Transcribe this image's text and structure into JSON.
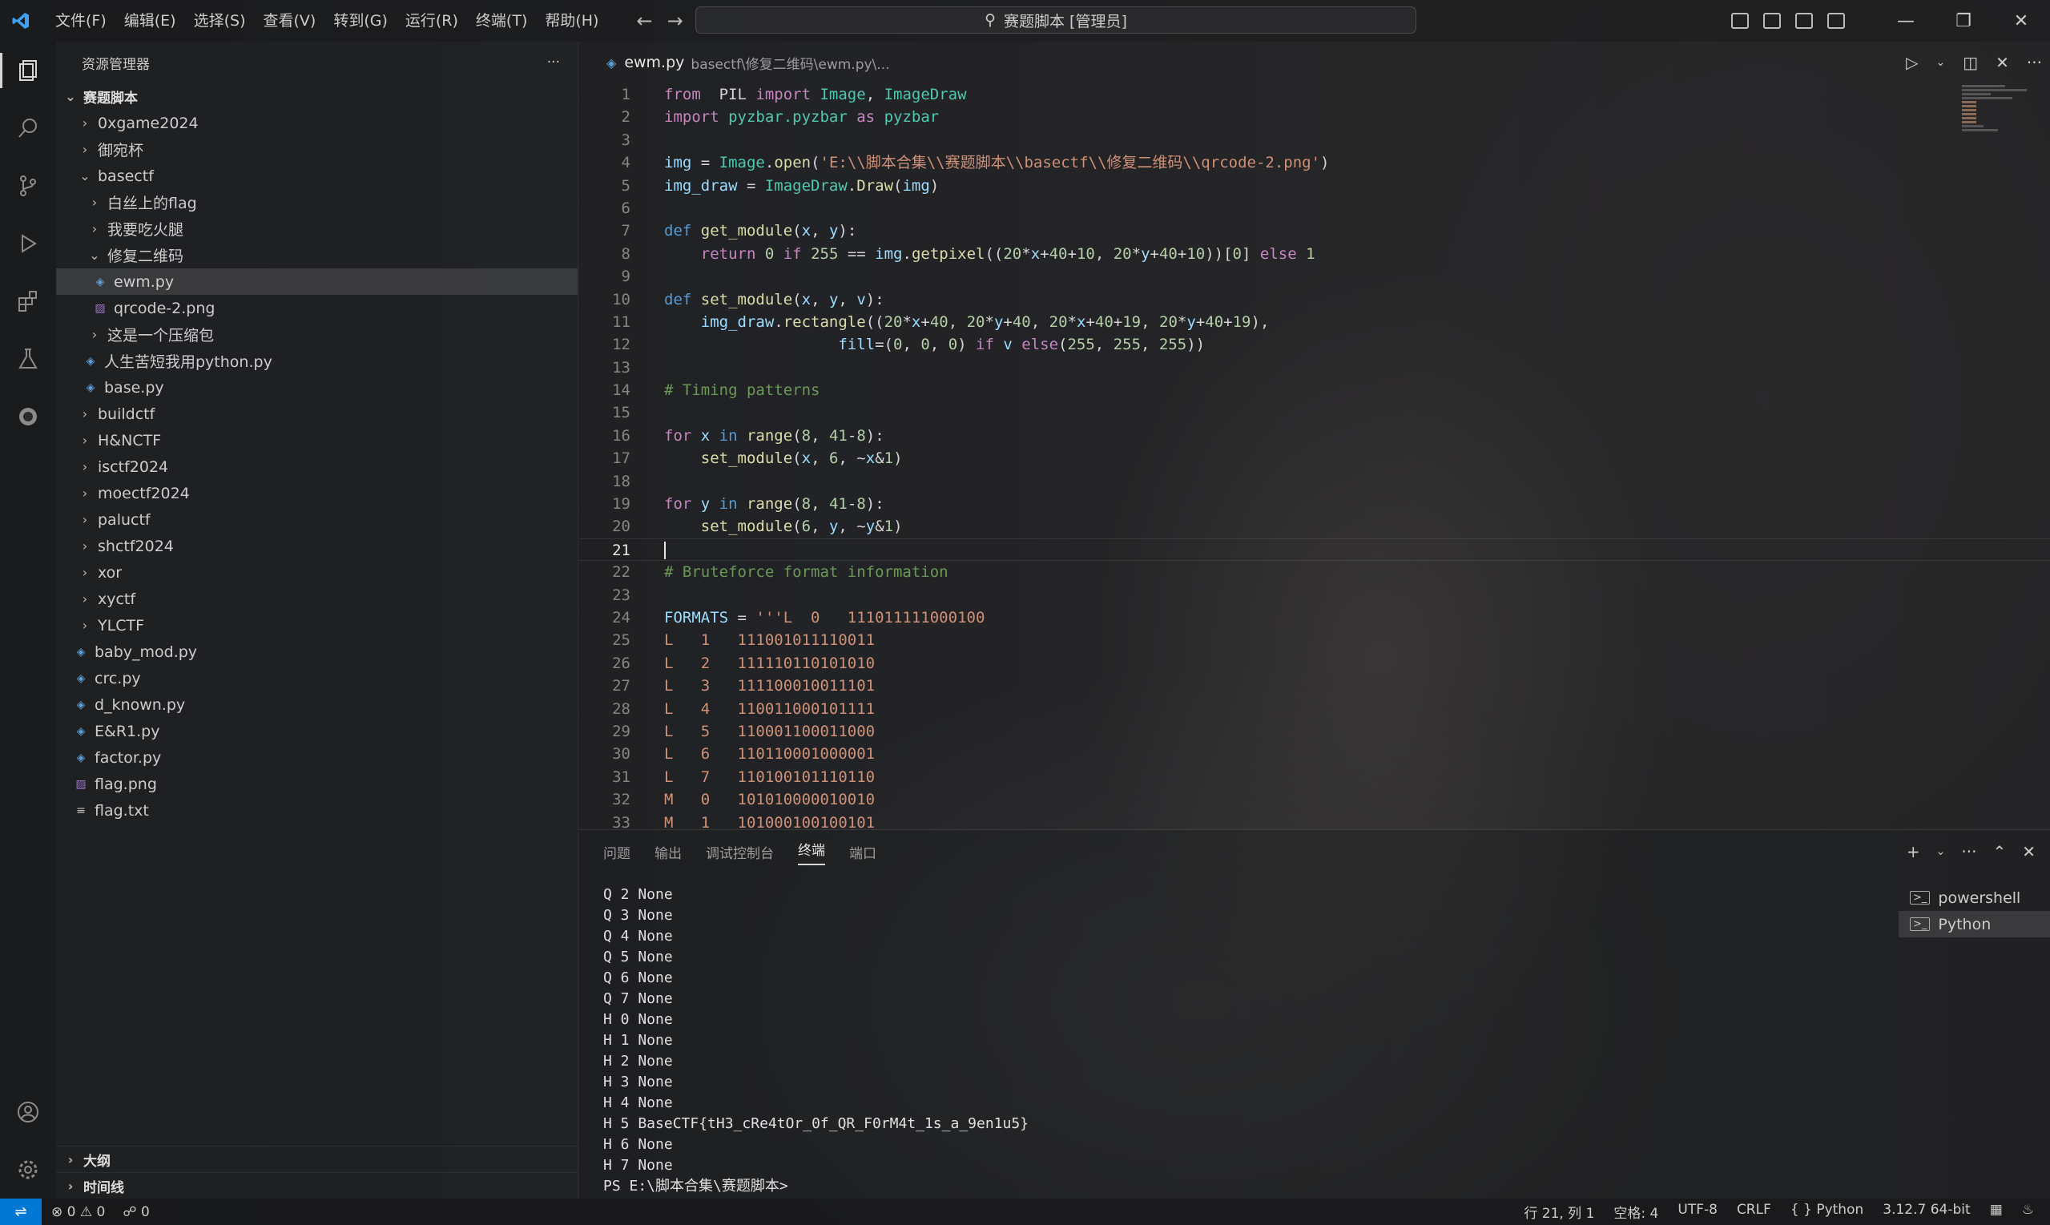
{
  "titlebar": {
    "menus": [
      "文件(F)",
      "编辑(E)",
      "选择(S)",
      "查看(V)",
      "转到(G)",
      "运行(R)",
      "终端(T)",
      "帮助(H)"
    ],
    "search": "赛题脚本 [管理员]"
  },
  "sidebar": {
    "header": "资源管理器",
    "root": "赛题脚本",
    "tree": [
      {
        "label": "0xgame2024",
        "indent": 1,
        "type": "folder",
        "open": false
      },
      {
        "label": "御宛杯",
        "indent": 1,
        "type": "folder",
        "open": false
      },
      {
        "label": "basectf",
        "indent": 1,
        "type": "folder",
        "open": true
      },
      {
        "label": "白丝上的flag",
        "indent": 2,
        "type": "folder",
        "open": false
      },
      {
        "label": "我要吃火腿",
        "indent": 2,
        "type": "folder",
        "open": false
      },
      {
        "label": "修复二维码",
        "indent": 2,
        "type": "folder",
        "open": true
      },
      {
        "label": "ewm.py",
        "indent": 3,
        "type": "py",
        "selected": true
      },
      {
        "label": "qrcode-2.png",
        "indent": 3,
        "type": "png"
      },
      {
        "label": "这是一个压缩包",
        "indent": 2,
        "type": "folder",
        "open": false
      },
      {
        "label": "人生苦短我用python.py",
        "indent": 2,
        "type": "py"
      },
      {
        "label": "base.py",
        "indent": 2,
        "type": "py"
      },
      {
        "label": "buildctf",
        "indent": 1,
        "type": "folder",
        "open": false
      },
      {
        "label": "H&NCTF",
        "indent": 1,
        "type": "folder",
        "open": false
      },
      {
        "label": "isctf2024",
        "indent": 1,
        "type": "folder",
        "open": false
      },
      {
        "label": "moectf2024",
        "indent": 1,
        "type": "folder",
        "open": false
      },
      {
        "label": "paluctf",
        "indent": 1,
        "type": "folder",
        "open": false
      },
      {
        "label": "shctf2024",
        "indent": 1,
        "type": "folder",
        "open": false
      },
      {
        "label": "xor",
        "indent": 1,
        "type": "folder",
        "open": false
      },
      {
        "label": "xyctf",
        "indent": 1,
        "type": "folder",
        "open": false
      },
      {
        "label": "YLCTF",
        "indent": 1,
        "type": "folder",
        "open": false
      },
      {
        "label": "baby_mod.py",
        "indent": 1,
        "type": "py"
      },
      {
        "label": "crc.py",
        "indent": 1,
        "type": "py"
      },
      {
        "label": "d_known.py",
        "indent": 1,
        "type": "py"
      },
      {
        "label": "E&R1.py",
        "indent": 1,
        "type": "py"
      },
      {
        "label": "factor.py",
        "indent": 1,
        "type": "py"
      },
      {
        "label": "flag.png",
        "indent": 1,
        "type": "png"
      },
      {
        "label": "flag.txt",
        "indent": 1,
        "type": "txt"
      }
    ],
    "outline": "大纲",
    "timeline": "时间线"
  },
  "editor": {
    "tab_title": "ewm.py",
    "tab_path": "basectf\\修复二维码\\ewm.py\\...",
    "current_line": 21,
    "lines": [
      [
        [
          "kw2",
          "from"
        ],
        [
          "",
          "  PIL "
        ],
        [
          "kw2",
          "import"
        ],
        [
          "cls",
          " Image"
        ],
        [
          "",
          ", "
        ],
        [
          "cls",
          "ImageDraw"
        ]
      ],
      [
        [
          "kw2",
          "import"
        ],
        [
          "cls",
          " pyzbar.pyzbar"
        ],
        [
          "kw2",
          " as"
        ],
        [
          "cls",
          " pyzbar"
        ]
      ],
      [],
      [
        [
          "var",
          "img"
        ],
        [
          "",
          " = "
        ],
        [
          "cls",
          "Image"
        ],
        [
          "",
          "."
        ],
        [
          "fn",
          "open"
        ],
        [
          "",
          "("
        ],
        [
          "str",
          "'E:\\\\脚本合集\\\\赛题脚本\\\\basectf\\\\修复二维码\\\\qrcode-2.png'"
        ],
        [
          "",
          ")"
        ]
      ],
      [
        [
          "var",
          "img_draw"
        ],
        [
          "",
          " = "
        ],
        [
          "cls",
          "ImageDraw"
        ],
        [
          "",
          "."
        ],
        [
          "fn",
          "Draw"
        ],
        [
          "",
          "("
        ],
        [
          "var",
          "img"
        ],
        [
          "",
          ")"
        ]
      ],
      [],
      [
        [
          "kw",
          "def"
        ],
        [
          "fn",
          " get_module"
        ],
        [
          "",
          "("
        ],
        [
          "var",
          "x"
        ],
        [
          "",
          ", "
        ],
        [
          "var",
          "y"
        ],
        [
          "",
          "):"
        ]
      ],
      [
        [
          "",
          "    "
        ],
        [
          "kw2",
          "return"
        ],
        [
          "num",
          " 0"
        ],
        [
          "kw2",
          " if"
        ],
        [
          "num",
          " 255"
        ],
        [
          "",
          " == "
        ],
        [
          "var",
          "img"
        ],
        [
          "",
          "."
        ],
        [
          "fn",
          "getpixel"
        ],
        [
          "",
          "(("
        ],
        [
          "num",
          "20"
        ],
        [
          "",
          "*"
        ],
        [
          "var",
          "x"
        ],
        [
          "",
          "+"
        ],
        [
          "num",
          "40"
        ],
        [
          "",
          "+"
        ],
        [
          "num",
          "10"
        ],
        [
          "",
          ", "
        ],
        [
          "num",
          "20"
        ],
        [
          "",
          "*"
        ],
        [
          "var",
          "y"
        ],
        [
          "",
          "+"
        ],
        [
          "num",
          "40"
        ],
        [
          "",
          "+"
        ],
        [
          "num",
          "10"
        ],
        [
          "",
          "))["
        ],
        [
          "num",
          "0"
        ],
        [
          "",
          "] "
        ],
        [
          "kw2",
          "else"
        ],
        [
          "num",
          " 1"
        ]
      ],
      [],
      [
        [
          "kw",
          "def"
        ],
        [
          "fn",
          " set_module"
        ],
        [
          "",
          "("
        ],
        [
          "var",
          "x"
        ],
        [
          "",
          ", "
        ],
        [
          "var",
          "y"
        ],
        [
          "",
          ", "
        ],
        [
          "var",
          "v"
        ],
        [
          "",
          "):"
        ]
      ],
      [
        [
          "",
          "    "
        ],
        [
          "var",
          "img_draw"
        ],
        [
          "",
          "."
        ],
        [
          "fn",
          "rectangle"
        ],
        [
          "",
          "(("
        ],
        [
          "num",
          "20"
        ],
        [
          "",
          "*"
        ],
        [
          "var",
          "x"
        ],
        [
          "",
          "+"
        ],
        [
          "num",
          "40"
        ],
        [
          "",
          ", "
        ],
        [
          "num",
          "20"
        ],
        [
          "",
          "*"
        ],
        [
          "var",
          "y"
        ],
        [
          "",
          "+"
        ],
        [
          "num",
          "40"
        ],
        [
          "",
          ", "
        ],
        [
          "num",
          "20"
        ],
        [
          "",
          "*"
        ],
        [
          "var",
          "x"
        ],
        [
          "",
          "+"
        ],
        [
          "num",
          "40"
        ],
        [
          "",
          "+"
        ],
        [
          "num",
          "19"
        ],
        [
          "",
          ", "
        ],
        [
          "num",
          "20"
        ],
        [
          "",
          "*"
        ],
        [
          "var",
          "y"
        ],
        [
          "",
          "+"
        ],
        [
          "num",
          "40"
        ],
        [
          "",
          "+"
        ],
        [
          "num",
          "19"
        ],
        [
          "",
          "),"
        ]
      ],
      [
        [
          "",
          "                   "
        ],
        [
          "var",
          "fill"
        ],
        [
          "",
          "=("
        ],
        [
          "num",
          "0"
        ],
        [
          "",
          ", "
        ],
        [
          "num",
          "0"
        ],
        [
          "",
          ", "
        ],
        [
          "num",
          "0"
        ],
        [
          "",
          ") "
        ],
        [
          "kw2",
          "if"
        ],
        [
          "var",
          " v"
        ],
        [
          "kw2",
          " else"
        ],
        [
          "",
          "",
          " ("
        ],
        [
          "",
          "("
        ],
        [
          "num",
          "255"
        ],
        [
          "",
          ", "
        ],
        [
          "num",
          "255"
        ],
        [
          "",
          ", "
        ],
        [
          "num",
          "255"
        ],
        [
          "",
          "))"
        ]
      ],
      [],
      [
        [
          "cm",
          "# Timing patterns"
        ]
      ],
      [],
      [
        [
          "kw2",
          "for"
        ],
        [
          "var",
          " x"
        ],
        [
          "kw",
          " in"
        ],
        [
          "fn",
          " range"
        ],
        [
          "",
          "("
        ],
        [
          "num",
          "8"
        ],
        [
          "",
          ", "
        ],
        [
          "num",
          "41"
        ],
        [
          "",
          "-"
        ],
        [
          "num",
          "8"
        ],
        [
          "",
          "):"
        ]
      ],
      [
        [
          "",
          "    "
        ],
        [
          "fn",
          "set_module"
        ],
        [
          "",
          "("
        ],
        [
          "var",
          "x"
        ],
        [
          "",
          ", "
        ],
        [
          "num",
          "6"
        ],
        [
          "",
          ", ~"
        ],
        [
          "var",
          "x"
        ],
        [
          "",
          "&"
        ],
        [
          "num",
          "1"
        ],
        [
          "",
          ")"
        ]
      ],
      [],
      [
        [
          "kw2",
          "for"
        ],
        [
          "var",
          " y"
        ],
        [
          "kw",
          " in"
        ],
        [
          "fn",
          " range"
        ],
        [
          "",
          "("
        ],
        [
          "num",
          "8"
        ],
        [
          "",
          ", "
        ],
        [
          "num",
          "41"
        ],
        [
          "",
          "-"
        ],
        [
          "num",
          "8"
        ],
        [
          "",
          "):"
        ]
      ],
      [
        [
          "",
          "    "
        ],
        [
          "fn",
          "set_module"
        ],
        [
          "",
          "("
        ],
        [
          "num",
          "6"
        ],
        [
          "",
          ", "
        ],
        [
          "var",
          "y"
        ],
        [
          "",
          ", ~"
        ],
        [
          "var",
          "y"
        ],
        [
          "",
          "&"
        ],
        [
          "num",
          "1"
        ],
        [
          "",
          ")"
        ]
      ],
      [],
      [
        [
          "cm",
          "# Bruteforce format information"
        ]
      ],
      [],
      [
        [
          "var",
          "FORMATS"
        ],
        [
          "",
          " = "
        ],
        [
          "str",
          "'''L  0   111011111000100"
        ]
      ],
      [
        [
          "str",
          "L   1   111001011110011"
        ]
      ],
      [
        [
          "str",
          "L   2   111110110101010"
        ]
      ],
      [
        [
          "str",
          "L   3   111100010011101"
        ]
      ],
      [
        [
          "str",
          "L   4   110011000101111"
        ]
      ],
      [
        [
          "str",
          "L   5   110001100011000"
        ]
      ],
      [
        [
          "str",
          "L   6   110110001000001"
        ]
      ],
      [
        [
          "str",
          "L   7   110100101110110"
        ]
      ],
      [
        [
          "str",
          "M   0   101010000010010"
        ]
      ],
      [
        [
          "str",
          "M   1   101000100100101"
        ]
      ]
    ]
  },
  "panel": {
    "tabs": [
      "问题",
      "输出",
      "调试控制台",
      "终端",
      "端口"
    ],
    "active_tab": "终端",
    "terminal_lines": [
      "Q 2 None",
      "Q 3 None",
      "Q 4 None",
      "Q 5 None",
      "Q 6 None",
      "Q 7 None",
      "H 0 None",
      "H 1 None",
      "H 2 None",
      "H 3 None",
      "H 4 None",
      "H 5 BaseCTF{tH3_cRe4tOr_0f_QR_F0rM4t_1s_a_9en1u5}",
      "H 6 None",
      "H 7 None",
      "PS E:\\脚本合集\\赛题脚本> "
    ],
    "terminals": [
      "powershell",
      "Python"
    ]
  },
  "statusbar": {
    "errors": "0",
    "warnings": "0",
    "ports": "0",
    "position": "行 21, 列 1",
    "spaces": "空格: 4",
    "encoding": "UTF-8",
    "eol": "CRLF",
    "language": "Python",
    "interpreter": "3.12.7 64-bit"
  }
}
